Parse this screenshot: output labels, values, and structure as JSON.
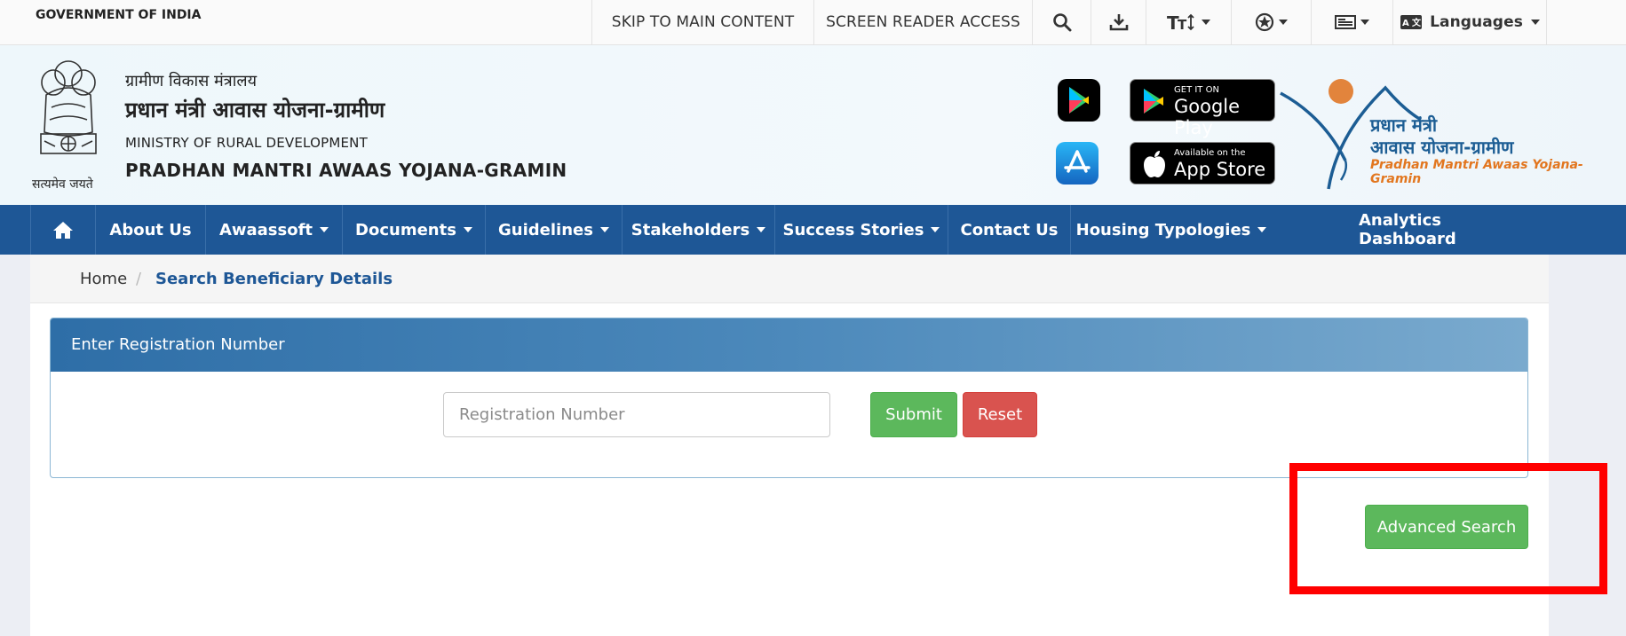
{
  "topbar": {
    "gov_label": "GOVERNMENT OF INDIA",
    "skip": "SKIP TO MAIN CONTENT",
    "screen_reader": "SCREEN READER ACCESS",
    "languages": "Languages",
    "icons": [
      "search-icon",
      "download-icon",
      "text-size-icon",
      "contrast-icon",
      "sitemap-icon",
      "language-icon"
    ]
  },
  "header": {
    "hindi_ministry": "ग्रामीण विकास मंत्रालय",
    "hindi_scheme": "प्रधान मंत्री आवास योजना-ग्रामीण",
    "eng_ministry": "MINISTRY OF RURAL DEVELOPMENT",
    "eng_scheme": "PRADHAN MANTRI AWAAS YOJANA-GRAMIN",
    "emblem_caption": "सत्यमेव जयते",
    "google_small": "GET IT ON",
    "google_big": "Google Play",
    "apple_small": "Available on the",
    "apple_big": "App Store",
    "logo_line1": "प्रधान मंत्री",
    "logo_line2": "आवास योजना-ग्रामीण",
    "logo_line3": "Pradhan Mantri Awaas Yojana-Gramin"
  },
  "nav": {
    "items": [
      {
        "label": "About Us"
      },
      {
        "label": "Awaassoft"
      },
      {
        "label": "Documents"
      },
      {
        "label": "Guidelines"
      },
      {
        "label": "Stakeholders"
      },
      {
        "label": "Success Stories"
      },
      {
        "label": "Contact Us"
      },
      {
        "label": "Housing Typologies"
      },
      {
        "label": "Analytics Dashboard"
      }
    ]
  },
  "breadcrumb": {
    "home": "Home",
    "separator": "/",
    "current": "Search Beneficiary Details"
  },
  "form": {
    "panel_title": "Enter Registration Number",
    "placeholder": "Registration Number",
    "submit": "Submit",
    "reset": "Reset",
    "advanced": "Advanced Search"
  },
  "colors": {
    "nav_bg": "#1e5796",
    "success": "#5cb85c",
    "danger": "#d9534f",
    "highlight": "#ff0000"
  }
}
